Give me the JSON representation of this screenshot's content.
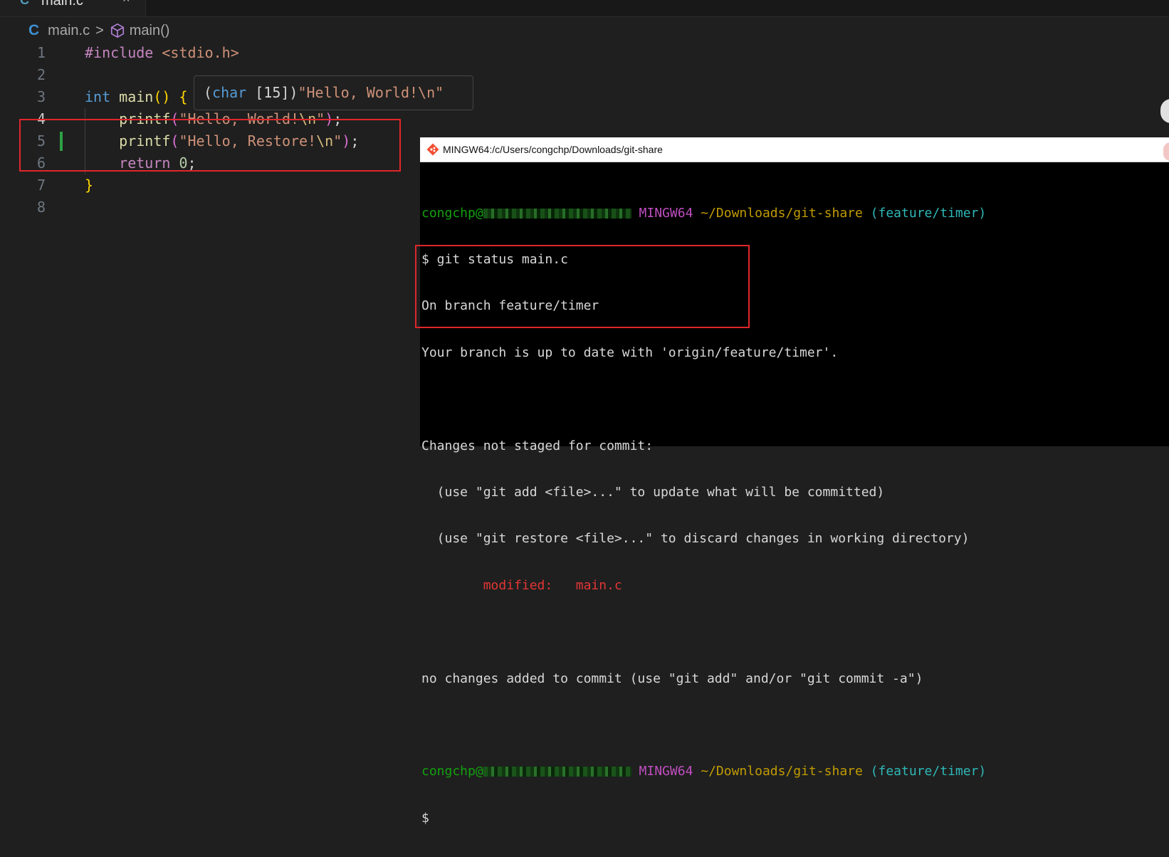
{
  "tab": {
    "icon": "C",
    "label": "main.c",
    "close_icon": "close-icon"
  },
  "breadcrumb": {
    "file_icon": "C",
    "file": "main.c",
    "separator": ">",
    "symbol_icon": "cube-icon",
    "symbol": "main()"
  },
  "editor": {
    "line_numbers": [
      "1",
      "2",
      "3",
      "4",
      "5",
      "6",
      "7",
      "8"
    ],
    "lines": {
      "l1_directive": "#include",
      "l1_header": " <stdio.h>",
      "l3_type": "int",
      "l3_fn": "main",
      "l3_parens": "()",
      "l3_brace": "{",
      "l4_fn": "printf",
      "l4_open": "(",
      "l4_str": "\"Hello, World!",
      "l4_esc": "\\n",
      "l4_strend": "\"",
      "l4_close": ")",
      "l4_semi": ";",
      "l5_fn": "printf",
      "l5_open": "(",
      "l5_str": "\"Hello, Restore!",
      "l5_esc": "\\n",
      "l5_strend": "\"",
      "l5_close": ")",
      "l5_semi": ";",
      "l6_kw": "return",
      "l6_num": "0",
      "l6_semi": ";",
      "l7_brace": "}"
    },
    "hover": {
      "open": "(",
      "type": "char",
      "rest": " [15])",
      "value": "\"Hello, World!\\n\""
    }
  },
  "terminal": {
    "title": "MINGW64:/c/Users/congchp/Downloads/git-share",
    "user": "congchp@",
    "env": "MINGW64",
    "path": "~/Downloads/git-share",
    "branch": "(feature/timer)",
    "lines": {
      "cmd": "$ git status main.c",
      "on_branch": "On branch feature/timer",
      "up_to_date": "Your branch is up to date with 'origin/feature/timer'.",
      "not_staged": "Changes not staged for commit:",
      "hint_add": "  (use \"git add <file>...\" to update what will be committed)",
      "hint_restore": "  (use \"git restore <file>...\" to discard changes in working directory)",
      "modified_label": "        modified:   ",
      "modified_file": "main.c",
      "no_changes": "no changes added to commit (use \"git add\" and/or \"git commit -a\")",
      "prompt": "$"
    }
  },
  "colors": {
    "highlight_box": "#e0262b",
    "git_added_gutter": "#2ea043",
    "terminal_green": "#13a10e",
    "terminal_magenta": "#c04ec0",
    "terminal_yellow": "#c19c00",
    "terminal_cyan": "#2fb8b8",
    "terminal_red": "#e33535"
  }
}
